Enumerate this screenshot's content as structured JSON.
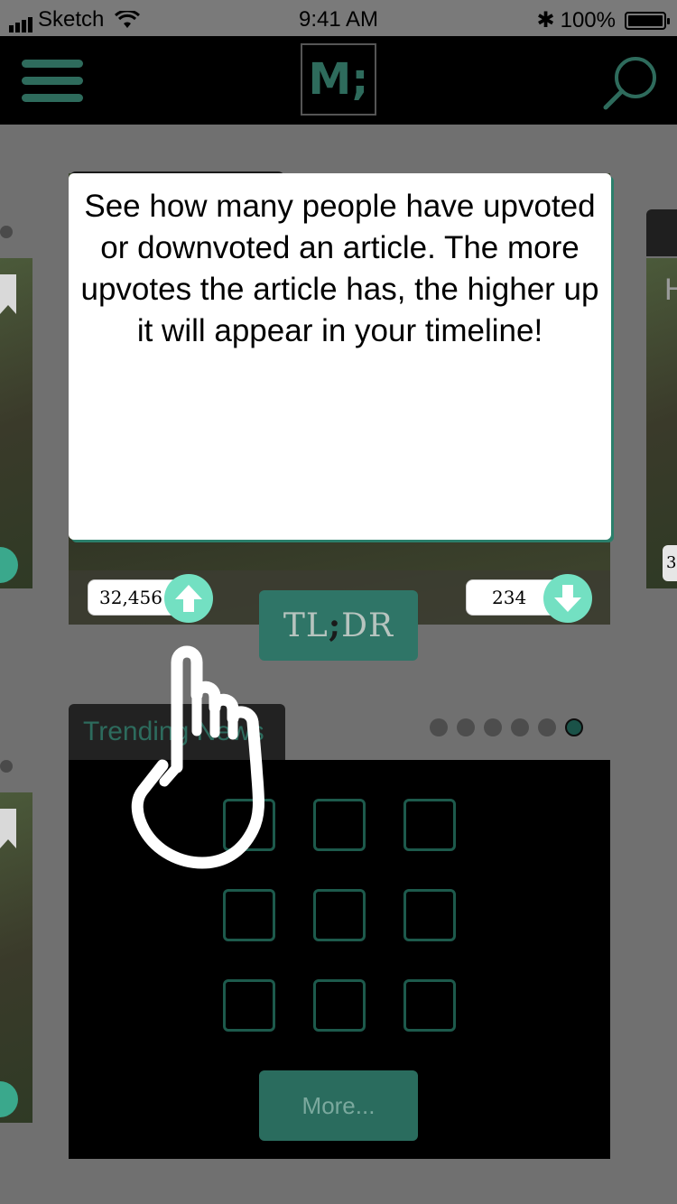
{
  "status_bar": {
    "carrier": "Sketch",
    "time": "9:41 AM",
    "battery": "100%"
  },
  "nav": {
    "logo_text": "M;"
  },
  "tooltip": {
    "text": "See how many people have upvoted or downvoted an article. The more upvotes the article has, the higher up it will appear in your timeline!"
  },
  "article": {
    "upvotes": "32,456",
    "downvotes": "234"
  },
  "tldr_button": {
    "left": "TL",
    "semicolon": ";",
    "right": "DR"
  },
  "trending": {
    "title": "Trending News",
    "page_count": 6,
    "active_page": 6,
    "more_label": "More..."
  },
  "side_cards": {
    "right_partial_letter": "H",
    "right_partial_count": "3"
  },
  "colors": {
    "accent": "#2f7567",
    "vote_button": "#73e0c2",
    "nav_bg": "#000000"
  },
  "icons": {
    "menu": "hamburger-icon",
    "search": "search-icon",
    "upvote": "arrow-up-icon",
    "downvote": "arrow-down-icon",
    "pointer": "hand-pointer-icon"
  }
}
